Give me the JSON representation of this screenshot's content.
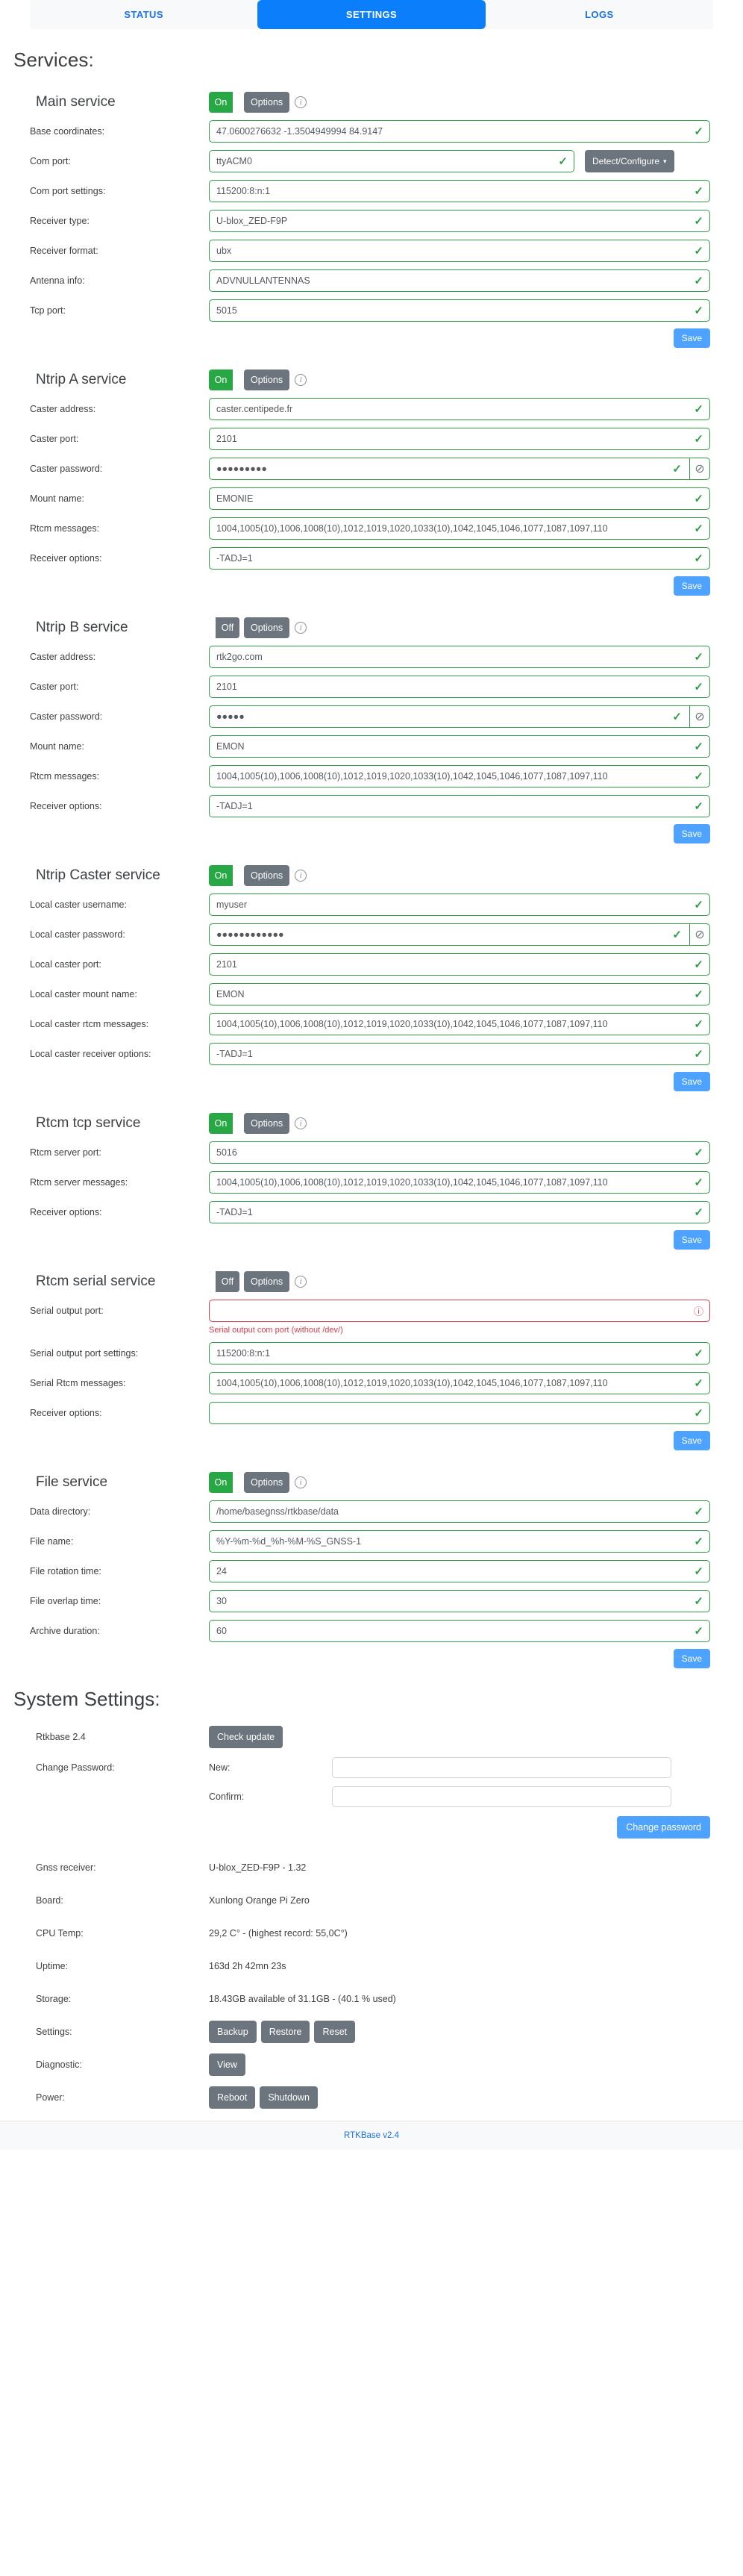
{
  "tabs": [
    {
      "label": "STATUS",
      "active": false
    },
    {
      "label": "SETTINGS",
      "active": true
    },
    {
      "label": "LOGS",
      "active": false
    }
  ],
  "services_heading": "Services:",
  "common": {
    "on_label": "On",
    "off_label": "Off",
    "options_label": "Options",
    "save_label": "Save",
    "info_glyph": "i",
    "tick_glyph": "✓",
    "error_glyph": "ⓘ",
    "eye_glyph": "⊘",
    "caret_glyph": "▾"
  },
  "rtcm_message_list": "1004,1005(10),1006,1008(10),1012,1019,1020,1033(10),1042,1045,1046,1077,1087,1097,110",
  "services": [
    {
      "title": "Main service",
      "toggle_state": "On",
      "fields": [
        {
          "label": "Base coordinates:",
          "value": "47.0600276632 -1.3504949994 84.9147",
          "state": "ok"
        },
        {
          "label": "Com port:",
          "value": "ttyACM0",
          "state": "ok",
          "narrow": true,
          "button": "Detect/Configure"
        },
        {
          "label": "Com port settings:",
          "value": "115200:8:n:1",
          "state": "ok"
        },
        {
          "label": "Receiver type:",
          "value": "U-blox_ZED-F9P",
          "state": "ok"
        },
        {
          "label": "Receiver format:",
          "value": "ubx",
          "state": "ok"
        },
        {
          "label": "Antenna info:",
          "value": "ADVNULLANTENNAS",
          "state": "ok"
        },
        {
          "label": "Tcp port:",
          "value": "5015",
          "state": "ok"
        }
      ]
    },
    {
      "title": "Ntrip A service",
      "toggle_state": "On",
      "fields": [
        {
          "label": "Caster address:",
          "value": "caster.centipede.fr",
          "state": "ok"
        },
        {
          "label": "Caster port:",
          "value": "2101",
          "state": "ok"
        },
        {
          "label": "Caster password:",
          "value": "●●●●●●●●●",
          "state": "ok",
          "eye": true
        },
        {
          "label": "Mount name:",
          "value": "EMONIE",
          "state": "ok"
        },
        {
          "label": "Rtcm messages:",
          "value": "1004,1005(10),1006,1008(10),1012,1019,1020,1033(10),1042,1045,1046,1077,1087,1097,110",
          "state": "ok"
        },
        {
          "label": "Receiver options:",
          "value": "-TADJ=1",
          "state": "ok"
        }
      ]
    },
    {
      "title": "Ntrip B service",
      "toggle_state": "Off",
      "fields": [
        {
          "label": "Caster address:",
          "value": "rtk2go.com",
          "state": "ok"
        },
        {
          "label": "Caster port:",
          "value": "2101",
          "state": "ok"
        },
        {
          "label": "Caster password:",
          "value": "●●●●●",
          "state": "ok",
          "eye": true
        },
        {
          "label": "Mount name:",
          "value": "EMON",
          "state": "ok"
        },
        {
          "label": "Rtcm messages:",
          "value": "1004,1005(10),1006,1008(10),1012,1019,1020,1033(10),1042,1045,1046,1077,1087,1097,110",
          "state": "ok"
        },
        {
          "label": "Receiver options:",
          "value": "-TADJ=1",
          "state": "ok"
        }
      ]
    },
    {
      "title": "Ntrip Caster service",
      "toggle_state": "On",
      "fields": [
        {
          "label": "Local caster username:",
          "value": "myuser",
          "state": "ok"
        },
        {
          "label": "Local caster password:",
          "value": "●●●●●●●●●●●●",
          "state": "ok",
          "eye": true
        },
        {
          "label": "Local caster port:",
          "value": "2101",
          "state": "ok"
        },
        {
          "label": "Local caster mount name:",
          "value": "EMON",
          "state": "ok"
        },
        {
          "label": "Local caster rtcm messages:",
          "value": "1004,1005(10),1006,1008(10),1012,1019,1020,1033(10),1042,1045,1046,1077,1087,1097,110",
          "state": "ok"
        },
        {
          "label": "Local caster receiver options:",
          "value": "-TADJ=1",
          "state": "ok"
        }
      ]
    },
    {
      "title": "Rtcm tcp service",
      "toggle_state": "On",
      "fields": [
        {
          "label": "Rtcm server port:",
          "value": "5016",
          "state": "ok"
        },
        {
          "label": "Rtcm server messages:",
          "value": "1004,1005(10),1006,1008(10),1012,1019,1020,1033(10),1042,1045,1046,1077,1087,1097,110",
          "state": "ok"
        },
        {
          "label": "Receiver options:",
          "value": "-TADJ=1",
          "state": "ok"
        }
      ]
    },
    {
      "title": "Rtcm serial service",
      "toggle_state": "Off",
      "fields": [
        {
          "label": "Serial output port:",
          "value": "",
          "state": "error",
          "help": "Serial output com port (without /dev/)"
        },
        {
          "label": "Serial output port settings:",
          "value": "115200:8:n:1",
          "state": "ok"
        },
        {
          "label": "Serial Rtcm messages:",
          "value": "1004,1005(10),1006,1008(10),1012,1019,1020,1033(10),1042,1045,1046,1077,1087,1097,110",
          "state": "ok"
        },
        {
          "label": "Receiver options:",
          "value": "",
          "state": "ok"
        }
      ]
    },
    {
      "title": "File service",
      "toggle_state": "On",
      "fields": [
        {
          "label": "Data directory:",
          "value": "/home/basegnss/rtkbase/data",
          "state": "ok"
        },
        {
          "label": "File name:",
          "value": "%Y-%m-%d_%h-%M-%S_GNSS-1",
          "state": "ok"
        },
        {
          "label": "File rotation time:",
          "value": "24",
          "state": "ok"
        },
        {
          "label": "File overlap time:",
          "value": "30",
          "state": "ok"
        },
        {
          "label": "Archive duration:",
          "value": "60",
          "state": "ok"
        }
      ]
    }
  ],
  "system": {
    "heading": "System Settings:",
    "version_label": "Rtkbase 2.4",
    "check_update_label": "Check update",
    "change_password_label": "Change Password:",
    "new_label": "New:",
    "confirm_label": "Confirm:",
    "new_value": "",
    "confirm_value": "",
    "change_password_button": "Change password",
    "info_rows": [
      {
        "label": "Gnss receiver:",
        "value": "U-blox_ZED-F9P - 1.32"
      },
      {
        "label": "Board:",
        "value": "Xunlong Orange Pi Zero"
      },
      {
        "label": "CPU Temp:",
        "value": "29,2 C° - (highest record: 55,0C°)"
      },
      {
        "label": "Uptime:",
        "value": "163d 2h 42mn 23s"
      },
      {
        "label": "Storage:",
        "value": "18.43GB available of 31.1GB - (40.1 % used)"
      }
    ],
    "settings_label": "Settings:",
    "settings_buttons": [
      "Backup",
      "Restore",
      "Reset"
    ],
    "diagnostic_label": "Diagnostic:",
    "diagnostic_buttons": [
      "View"
    ],
    "power_label": "Power:",
    "power_buttons": [
      "Reboot",
      "Shutdown"
    ]
  },
  "footer": {
    "text": "RTKBase v2.4"
  },
  "colors": {
    "accent": "#0b7ffb",
    "ok": "#2f9e44",
    "error": "#d63b4a",
    "grey": "#6c757d",
    "save": "#4da3ff"
  }
}
